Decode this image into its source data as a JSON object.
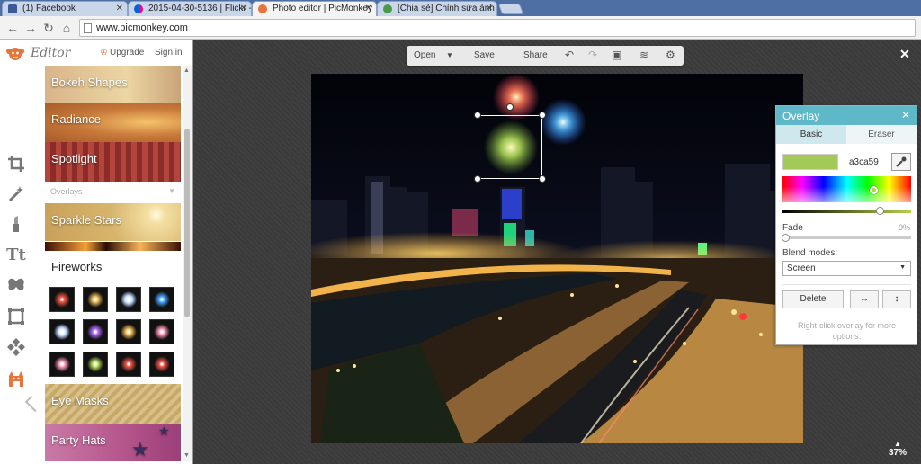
{
  "browser": {
    "tabs": [
      {
        "title": "(1) Facebook",
        "icon": "facebook-icon",
        "color": "#3b5998"
      },
      {
        "title": "2015-04-30-5136 | Flickr -",
        "icon": "flickr-icon",
        "color": "#ff0084"
      },
      {
        "title": "Photo editor | PicMonkey",
        "icon": "picmonkey-icon",
        "color": "#e8743b"
      },
      {
        "title": "[Chia sẻ] Chỉnh sửa ảnh tr",
        "icon": "site-icon",
        "color": "#4a9a4a"
      }
    ],
    "url": "www.picmonkey.com"
  },
  "editor": {
    "title": "Editor",
    "upgrade": "Upgrade",
    "sign_in": "Sign in",
    "tools": [
      "crop-icon",
      "magic-wand-icon",
      "lipstick-icon",
      "text-icon",
      "butterfly-icon",
      "frame-icon",
      "texture-icon",
      "themes-icon"
    ],
    "categories": {
      "bokeh": "Bokeh Shapes",
      "radiance": "Radiance",
      "spotlight": "Spotlight",
      "overlays": "Overlays",
      "sparkle": "Sparkle Stars",
      "fireworks": "Fireworks",
      "eye_masks": "Eye Masks",
      "party_hats": "Party Hats"
    }
  },
  "toolbar": {
    "open": "Open",
    "save": "Save",
    "share": "Share"
  },
  "zoom": "37%",
  "overlay_panel": {
    "title": "Overlay",
    "tab_basic": "Basic",
    "tab_eraser": "Eraser",
    "color_hex": "a3ca59",
    "color": "#a3ca59",
    "fade_label": "Fade",
    "fade_value": "0%",
    "blend_label": "Blend modes:",
    "blend_value": "Screen",
    "delete": "Delete",
    "hint": "Right-click overlay for more options."
  }
}
